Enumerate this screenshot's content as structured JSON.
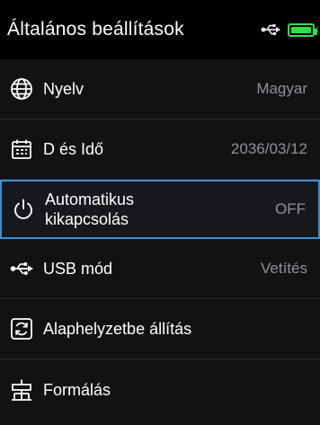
{
  "header": {
    "title": "Általános beállítások",
    "battery_level": 1.0,
    "battery_color": "#2ee04a"
  },
  "settings": [
    {
      "label": "Nyelv",
      "value": "Magyar",
      "icon": "globe-icon"
    },
    {
      "label": "D és Idő",
      "value": "2036/03/12",
      "icon": "calendar-icon"
    },
    {
      "label": "Automatikus kikapcsolás",
      "value": "OFF",
      "icon": "power-icon",
      "selected": true
    },
    {
      "label": "USB mód",
      "value": "Vetítés",
      "icon": "usb-icon"
    },
    {
      "label": "Alaphelyzetbe állítás",
      "value": "",
      "icon": "reset-icon"
    },
    {
      "label": "Formálás",
      "value": "",
      "icon": "format-icon"
    }
  ],
  "colors": {
    "accent": "#3d8fd8",
    "value_text": "#8e9196"
  }
}
